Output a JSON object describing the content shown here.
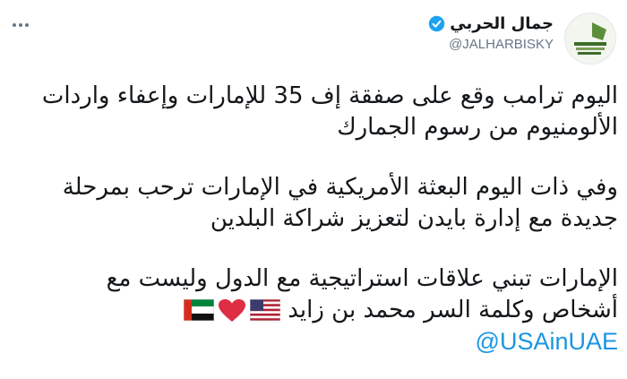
{
  "author": {
    "name": "جمال الحربي",
    "handle": "@JALHARBISKY",
    "verified": true,
    "avatar_icon": "profile-avatar"
  },
  "tweet": {
    "paragraphs": [
      {
        "lines": [
          "اليوم ترامب وقع على صفقة إف 35 للإمارات وإعفاء واردات",
          "الألومنيوم من رسوم الجمارك"
        ]
      },
      {
        "lines": [
          "وفي ذات اليوم البعثة الأمريكية في الإمارات ترحب بمرحلة",
          "جديدة مع إدارة بايدن لتعزيز شراكة البلدين"
        ]
      },
      {
        "lines": [
          "الإمارات تبني علاقات استراتيجية مع الدول وليست مع",
          "أشخاص وكلمة السر محمد بن زايد"
        ]
      }
    ],
    "emojis": [
      "us-flag",
      "red-heart",
      "uae-flag"
    ],
    "mention": "@USAinUAE"
  },
  "colors": {
    "link": "#1b95e0",
    "verified": "#1da1f2",
    "muted": "#657786"
  }
}
